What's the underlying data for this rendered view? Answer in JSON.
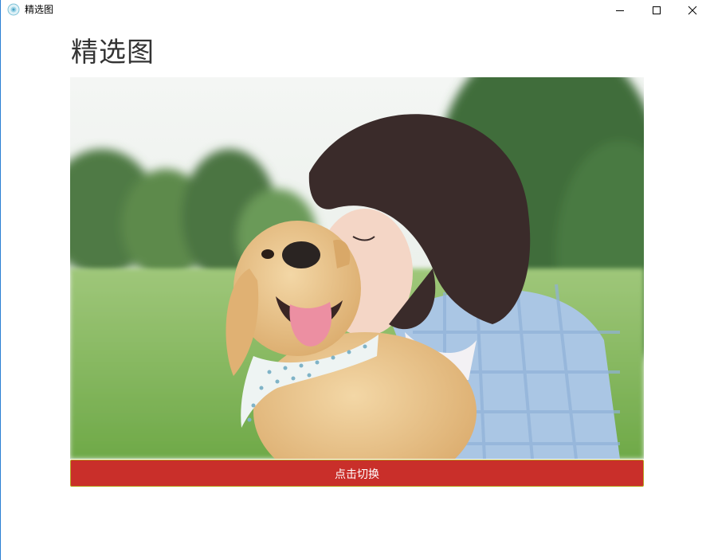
{
  "window": {
    "title": "精选图",
    "icon": "app-logo-icon",
    "controls": {
      "minimize_icon": "minimize-icon",
      "maximize_icon": "maximize-icon",
      "close_icon": "close-icon"
    }
  },
  "page": {
    "heading": "精选图"
  },
  "featured_image": {
    "subject": "woman-kissing-golden-retriever-puppy-photo"
  },
  "toggle_button": {
    "label": "点击切换",
    "color": "#c92f2a",
    "border_color": "#b8a21f"
  }
}
